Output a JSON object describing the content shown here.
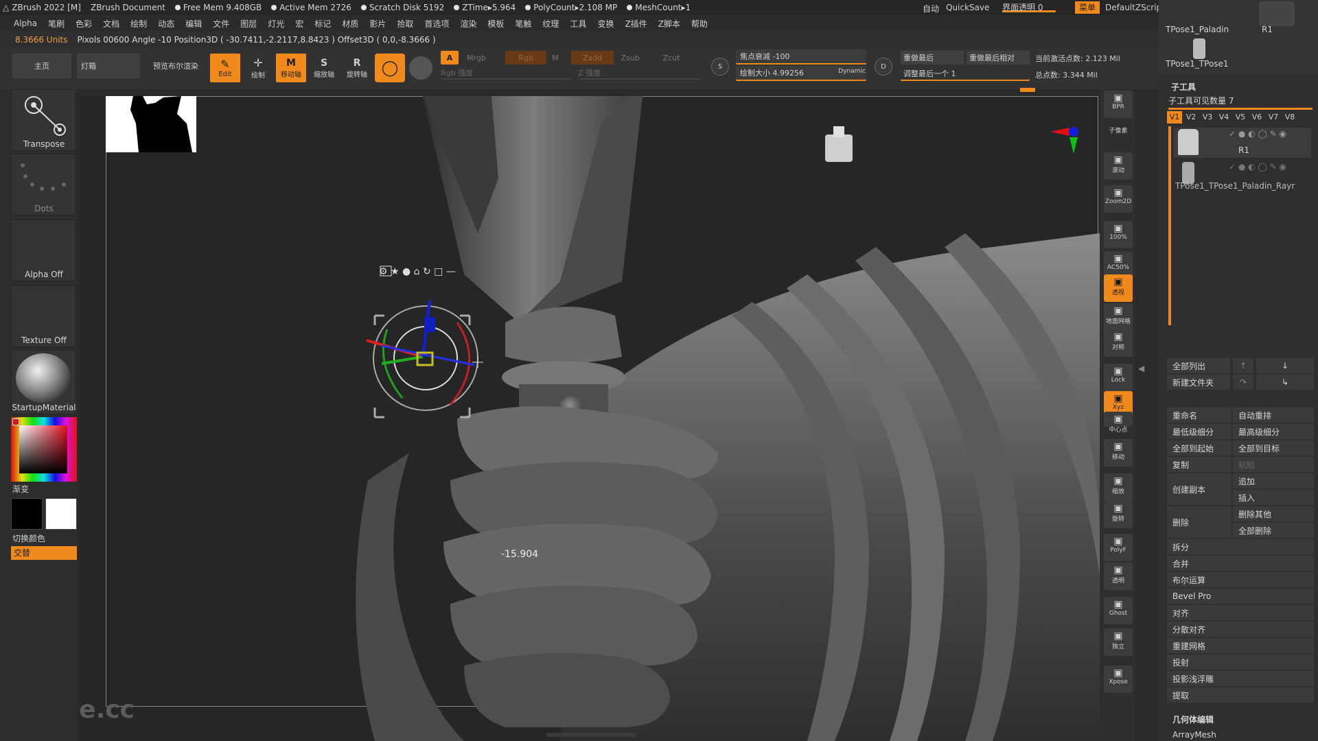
{
  "title_bar": {
    "app": "ZBrush 2022 [M]",
    "document": "ZBrush Document",
    "free_mem": "Free Mem 9.408GB",
    "active_mem": "Active Mem 2726",
    "scratch": "Scratch Disk 5192",
    "ztime": "ZTime▸5.964",
    "polycount": "PolyCount▸2.108 MP",
    "meshcount": "MeshCount▸1",
    "auto": "自动",
    "quicksave": "QuickSave",
    "ui_opacity": "界面透明 0",
    "menu": "菜单",
    "zscript": "DefaultZScript"
  },
  "menus": [
    "Alpha",
    "笔刷",
    "色彩",
    "文档",
    "绘制",
    "动态",
    "编辑",
    "文件",
    "图层",
    "灯光",
    "宏",
    "标记",
    "材质",
    "影片",
    "拾取",
    "首选项",
    "渲染",
    "模板",
    "笔触",
    "纹理",
    "工具",
    "变换",
    "Z插件",
    "Z脚本",
    "帮助"
  ],
  "info_bar": {
    "units": "8.3666 Units",
    "pixols": "Pixols 00600 Angle -10 Position3D ( -30.7411,-2.2117,8.8423 ) Offset3D ( 0,0,-8.3666 )"
  },
  "toolbar": {
    "home": "主页",
    "lightbox": "灯箱",
    "preview_bool": "预览布尔渲染",
    "edit": "Edit",
    "draw": "绘制",
    "move": "移动轴",
    "scale": "缩放轴",
    "rotate": "旋转轴",
    "a": "A",
    "mrgb": "Mrgb",
    "rgb": "Rgb",
    "m": "M",
    "zadd": "Zadd",
    "zsub": "Zsub",
    "zcut": "Zcut",
    "rgb_intensity": "Rgb 强度",
    "z_intensity": "Z 强度",
    "focal_shift": "焦点衰减 -100",
    "draw_size": "绘制大小 4.99256",
    "dynamic": "Dynamic",
    "s": "S",
    "d": "D",
    "redo_last": "重做最后",
    "redo_last_rel": "重做最后相对",
    "adjust_last": "调整最后一个 1",
    "active_points": "当前激活点数: 2.123 Mil",
    "total_points": "总点数: 3.344 Mil"
  },
  "left_panel": {
    "transpose": "Transpose",
    "dots": "Dots",
    "alpha_off": "Alpha Off",
    "texture_off": "Texture Off",
    "material": "StartupMaterial",
    "gradient": "渐变",
    "switch_color": "切换颜色",
    "alternate": "交替"
  },
  "viewport": {
    "measure": "-15.904",
    "watermark": "tafe.cc"
  },
  "right_tools": [
    "BPR",
    "子像素",
    "滚动",
    "Zoom2D",
    "100%",
    "AC50%",
    "透视",
    "地面网格",
    "对称",
    "Lock",
    "Xyz",
    "中心点",
    "移动",
    "缩放",
    "旋转",
    "PolyF",
    "透明",
    "Ghost",
    "独立",
    "Xpose"
  ],
  "right_panel": {
    "top_tools": [
      "TPose1_Paladin",
      "R1",
      "TPose1_TPose1"
    ],
    "subtool": "子工具",
    "visible_count": "子工具可见数量 7",
    "tabs": [
      "V1",
      "V2",
      "V3",
      "V4",
      "V5",
      "V6",
      "V7",
      "V8"
    ],
    "items": [
      "R1",
      "TPose1_TPose1_Paladin_Rayr"
    ],
    "list_all": "全部列出",
    "new_folder": "新建文件夹",
    "rename": "重命名",
    "auto_reorder": "自动重排",
    "lowest_sub": "最低级细分",
    "highest_sub": "最高级细分",
    "all_to_start": "全部到起始",
    "all_to_target": "全部到目标",
    "copy": "复制",
    "paste": "粘贴",
    "create_copy": "创建副本",
    "append": "追加",
    "insert": "插入",
    "delete": "删除",
    "delete_others": "删除其他",
    "delete_all": "全部删除",
    "split": "拆分",
    "merge": "合并",
    "boolean": "布尔运算",
    "bevel_pro": "Bevel Pro",
    "align": "对齐",
    "distribute": "分散对齐",
    "remesh": "重建网格",
    "project": "投射",
    "project_relief": "投影浅浮雕",
    "extract": "提取",
    "geometry_edit": "几何体编辑",
    "arraymesh": "ArrayMesh"
  }
}
